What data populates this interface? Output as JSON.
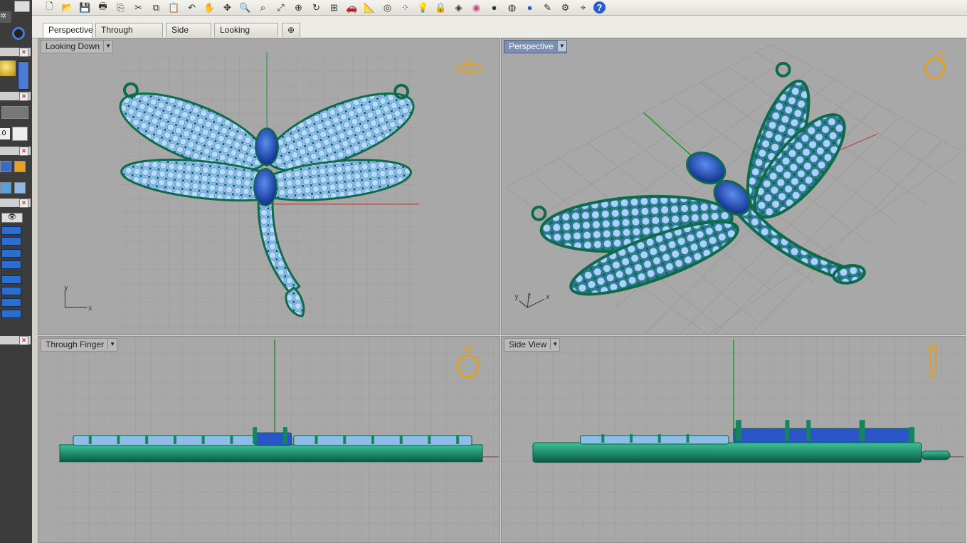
{
  "tabs": [
    {
      "label": "Perspective",
      "active": true
    },
    {
      "label": "Through Finger",
      "active": false
    },
    {
      "label": "Side View",
      "active": false
    },
    {
      "label": "Looking Down",
      "active": false
    }
  ],
  "tab_add_label": "⊕",
  "viewports": {
    "top_left": {
      "label": "Looking Down",
      "axis_x": "x",
      "axis_y": "y"
    },
    "top_right": {
      "label": "Perspective",
      "axis_x": "x",
      "axis_y": "y",
      "axis_z": "z"
    },
    "bottom_left": {
      "label": "Through Finger"
    },
    "bottom_right": {
      "label": "Side View"
    }
  },
  "left_panel": {
    "zoom_value": ".0"
  },
  "colors": {
    "viewport_bg": "#a8a8a8",
    "grid_line": "#999999",
    "gem_light": "#8fc1f0",
    "gem_dark": "#1a45b8",
    "metal": "#127a5c",
    "ring_icon": "#e0a020"
  },
  "toolbar_icons": [
    "new-icon",
    "open-icon",
    "save-icon",
    "print-icon",
    "import-icon",
    "cut-icon",
    "copy-icon",
    "paste-icon",
    "undo-icon",
    "pan-icon",
    "rotate-view-icon",
    "zoom-icon",
    "zoom-window-icon",
    "zoom-extents-icon",
    "zoom-selected-icon",
    "zoom-dynamic-icon",
    "four-views-icon",
    "car-icon",
    "ruler-icon",
    "snap-icon",
    "points-icon",
    "light-icon",
    "lock-icon",
    "layer-icon",
    "color-wheel-icon",
    "sphere-gray-icon",
    "sphere-metal-icon",
    "sphere-blue-icon",
    "brush-icon",
    "gears-icon",
    "gumball-icon",
    "help-icon"
  ]
}
